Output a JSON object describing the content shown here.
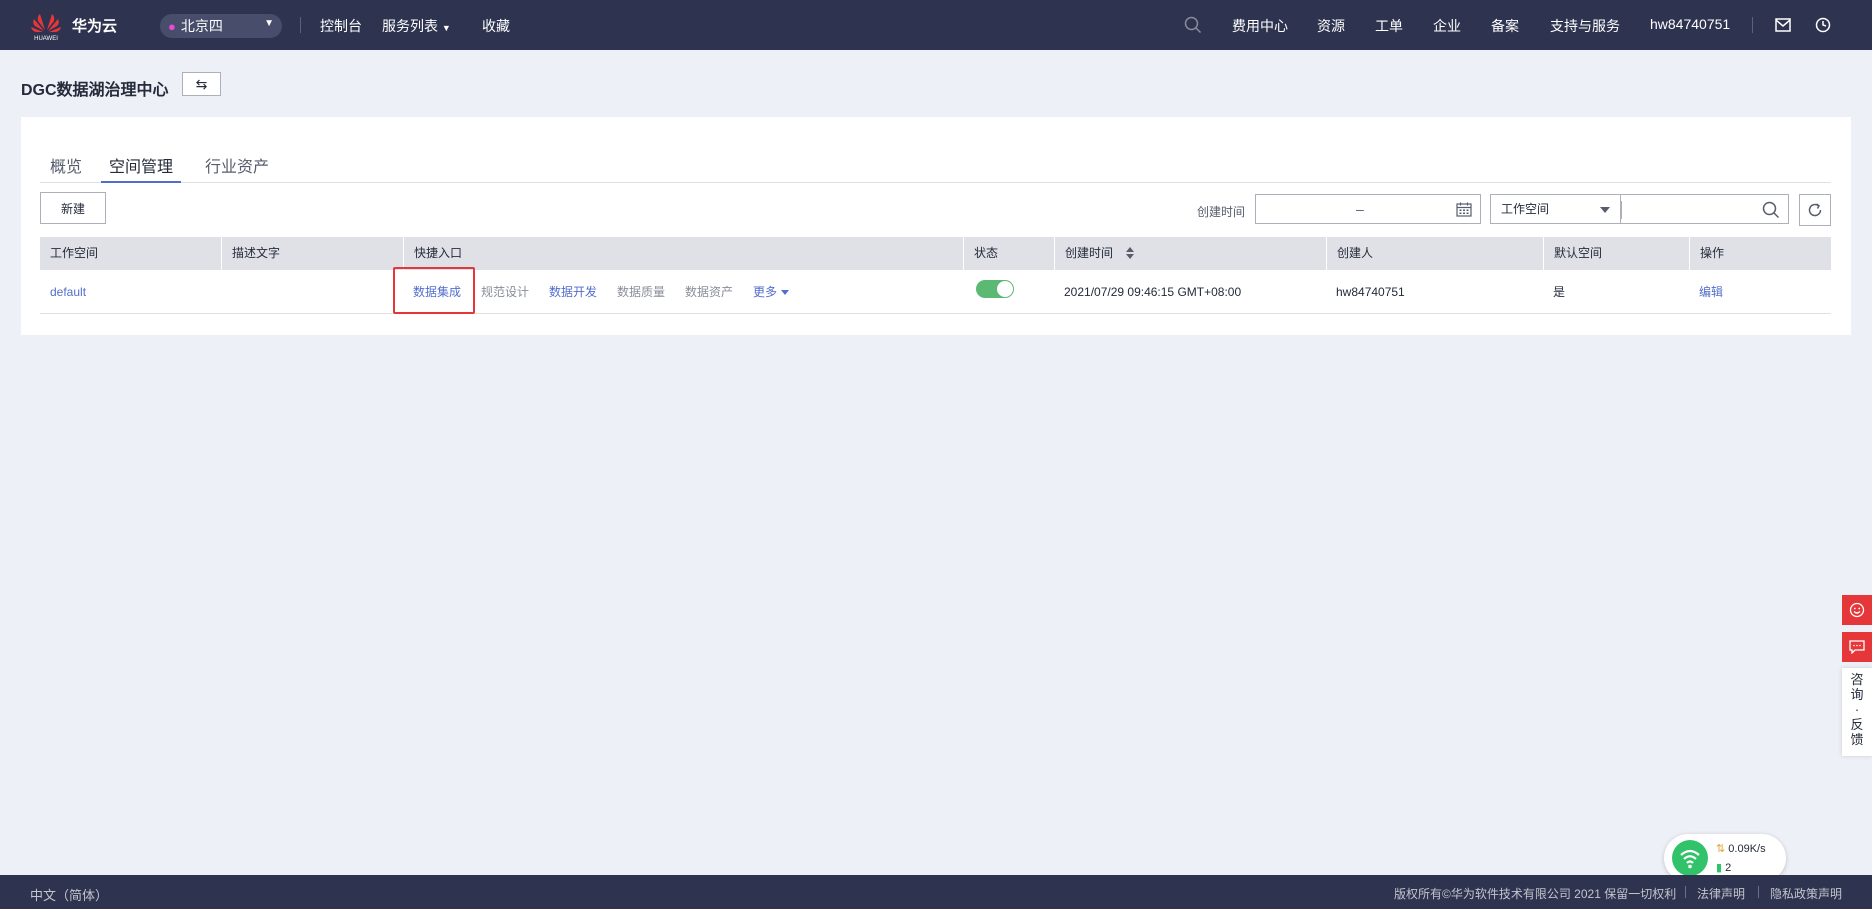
{
  "topbar": {
    "brand": "华为云",
    "logo_text": "HUAWEI",
    "region": "北京四",
    "links": [
      "控制台",
      "服务列表",
      "收藏"
    ],
    "right_links": [
      "费用中心",
      "资源",
      "工单",
      "企业",
      "备案",
      "支持与服务"
    ],
    "username": "hw84740751"
  },
  "service": {
    "title": "DGC数据湖治理中心",
    "switch_icon": "⇆"
  },
  "tabs": [
    "概览",
    "空间管理",
    "行业资产"
  ],
  "toolbar": {
    "new_label": "新建",
    "created_time_label": "创建时间",
    "date_separator": "–",
    "select_value": "工作空间"
  },
  "table": {
    "headers": [
      "工作空间",
      "描述文字",
      "快捷入口",
      "状态",
      "创建时间",
      "创建人",
      "默认空间",
      "操作"
    ],
    "rows": [
      {
        "workspace": "default",
        "description": "",
        "shortcuts": [
          "数据集成",
          "规范设计",
          "数据开发",
          "数据质量",
          "数据资产"
        ],
        "more": "更多",
        "status_on": true,
        "created_time": "2021/07/29 09:46:15 GMT+08:00",
        "creator": "hw84740751",
        "default_space": "是",
        "action": "编辑"
      }
    ]
  },
  "floating": {
    "consult_chars": [
      "咨",
      "询",
      "·",
      "反",
      "馈"
    ]
  },
  "net_widget": {
    "speed": "0.09K/s",
    "count": "2"
  },
  "footer": {
    "lang": "中文（简体）",
    "copyright": "版权所有©华为软件技术有限公司 2021 保留一切权利",
    "legal": "法律声明",
    "privacy": "隐私政策声明"
  },
  "colors": {
    "topbar_bg": "#2e3350",
    "link": "#526ecc",
    "highlight": "#e5373a",
    "toggle_on": "#5cb973"
  }
}
